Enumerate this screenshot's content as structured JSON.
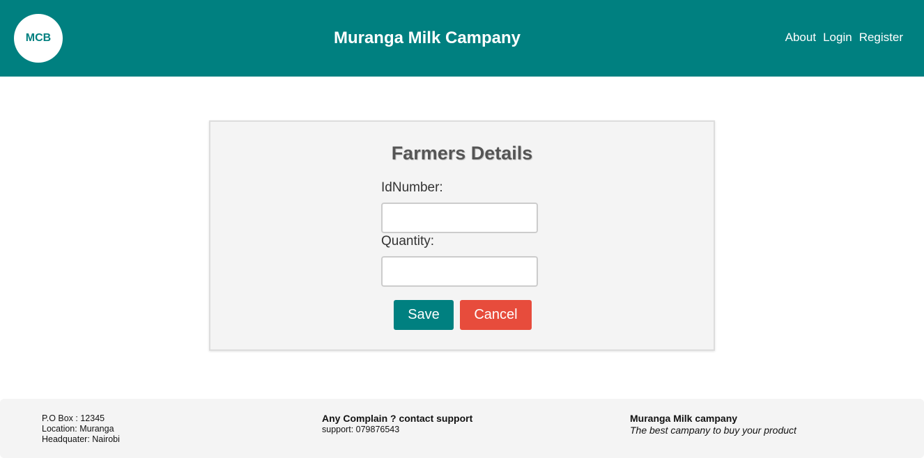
{
  "header": {
    "logo_text": "MCB",
    "title": "Muranga Milk Campany",
    "nav": {
      "about": "About",
      "login": "Login",
      "register": "Register"
    },
    "color": "#008080"
  },
  "form": {
    "title": "Farmers Details",
    "id_label": "IdNumber:",
    "id_value": "",
    "quantity_label": "Quantity:",
    "quantity_value": "",
    "save_label": "Save",
    "cancel_label": "Cancel",
    "save_color": "#008080",
    "cancel_color": "#e74c3c"
  },
  "footer": {
    "po_box": "P.O Box : 12345",
    "location": "Location: Muranga",
    "headquarter": "Headquater: Nairobi",
    "support_heading": "Any Complain ? contact support",
    "support_phone": "support: 079876543",
    "company_name": "Muranga Milk campany",
    "tagline": "The best campany to buy your product"
  }
}
